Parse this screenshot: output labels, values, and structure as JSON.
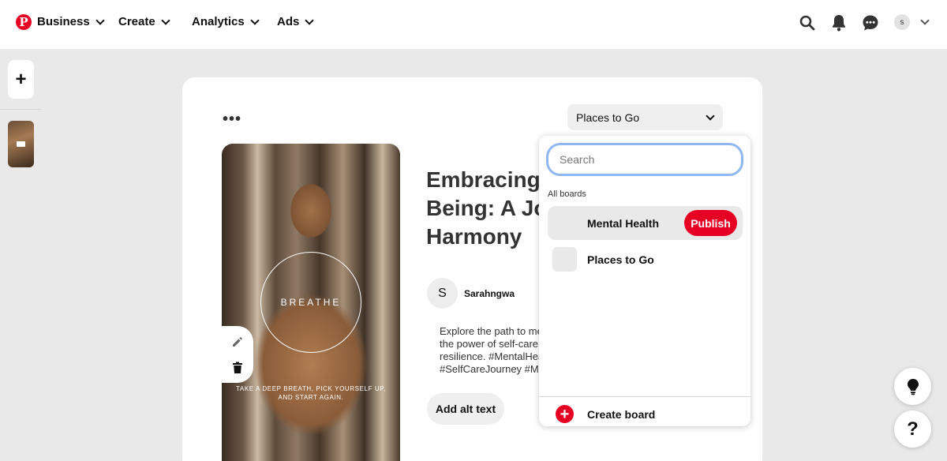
{
  "nav": {
    "logo": "P",
    "items": [
      "Business",
      "Create",
      "Analytics",
      "Ads"
    ],
    "account_initial": "s",
    "icons": [
      "search-icon",
      "bell-icon",
      "chat-icon"
    ]
  },
  "sidebar": {
    "add_label": "+"
  },
  "editor": {
    "more_label": "•••",
    "board_select": "Places to Go",
    "pin": {
      "overlay_title": "BREATHE",
      "caption": "TAKE A DEEP BREATH, PICK YOURSELF UP, AND START AGAIN."
    },
    "title_lines": [
      "Embracing Well-",
      "Being: A Journey to",
      "Harmony"
    ],
    "author": {
      "initial": "S",
      "name": "Sarahngwa"
    },
    "description_lines": [
      "Explore the path to mental",
      "the power of self-care and",
      "resilience. #MentalHealth",
      "#SelfCareJourney #M"
    ],
    "alt_text_button": "Add alt text"
  },
  "dropdown": {
    "search_placeholder": "Search",
    "section_label": "All boards",
    "boards": [
      {
        "name": "Mental Health",
        "action": "Publish"
      },
      {
        "name": "Places to Go"
      }
    ],
    "create_board": "Create board"
  },
  "colors": {
    "brand": "#e60023",
    "focus_ring": "#8fb7f0"
  },
  "help": {
    "question": "?"
  }
}
